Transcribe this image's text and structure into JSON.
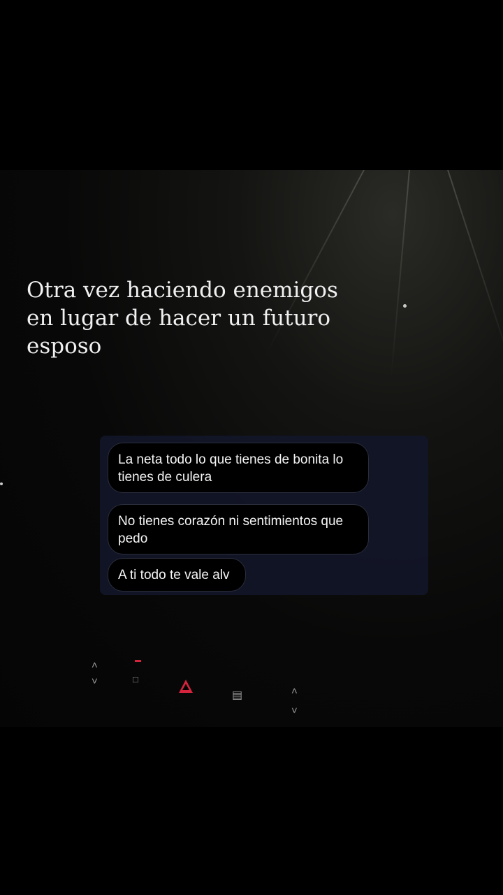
{
  "caption": "Otra vez haciendo enemigos en lugar de hacer un futuro esposo",
  "messages": [
    "La neta todo lo que tienes de bonita lo tienes de culera",
    "No tienes corazón ni sentimientos que pedo",
    "A ti todo te vale alv"
  ],
  "dashboard_icons": [
    "chevron-up-icon",
    "chevron-down-icon",
    "lock-icon",
    "hazard-icon",
    "defrost-icon",
    "chevron-up-icon",
    "chevron-down-icon"
  ]
}
